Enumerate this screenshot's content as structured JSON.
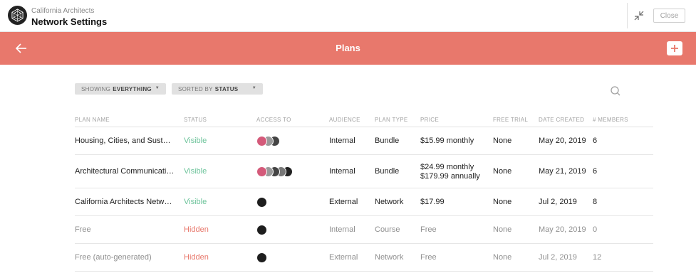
{
  "header": {
    "org_name": "California Architects",
    "page_name": "Network Settings",
    "close_label": "Close",
    "logo_icon": "hexagon-network-logo",
    "collapse_icon": "collapse-arrows-icon"
  },
  "banner": {
    "title": "Plans",
    "back_icon": "arrow-left-icon",
    "add_icon": "plus-icon",
    "color": "#e8786c"
  },
  "filters": {
    "showing_prefix": "SHOWING",
    "showing_value": "EVERYTHING",
    "sorted_prefix": "SORTED BY",
    "sorted_value": "STATUS",
    "search_icon": "search-icon"
  },
  "table": {
    "headers": [
      "PLAN NAME",
      "STATUS",
      "ACCESS TO",
      "AUDIENCE",
      "PLAN TYPE",
      "PRICE",
      "FREE TRIAL",
      "DATE CREATED",
      "# MEMBERS"
    ],
    "rows": [
      {
        "name": "Housing, Cities, and Sustain…",
        "status": "Visible",
        "access_count": 3,
        "audience": "Internal",
        "type": "Bundle",
        "price1": "$15.99 monthly",
        "price2": "",
        "trial": "None",
        "date": "May 20, 2019",
        "members": "6"
      },
      {
        "name": "Architectural Communicatio…",
        "status": "Visible",
        "access_count": 5,
        "audience": "Internal",
        "type": "Bundle",
        "price1": "$24.99 monthly",
        "price2": "$179.99 annually",
        "trial": "None",
        "date": "May 21, 2019",
        "members": "6"
      },
      {
        "name": "California Architects Networ…",
        "status": "Visible",
        "access_count": 1,
        "audience": "External",
        "type": "Network",
        "price1": "$17.99",
        "price2": "",
        "trial": "None",
        "date": "Jul 2, 2019",
        "members": "8"
      },
      {
        "name": "Free",
        "status": "Hidden",
        "access_count": 1,
        "audience": "Internal",
        "type": "Course",
        "price1": "Free",
        "price2": "",
        "trial": "None",
        "date": "May 20, 2019",
        "members": "0"
      },
      {
        "name": "Free (auto-generated)",
        "status": "Hidden",
        "access_count": 1,
        "audience": "External",
        "type": "Network",
        "price1": "Free",
        "price2": "",
        "trial": "None",
        "date": "Jul 2, 2019",
        "members": "12"
      }
    ]
  },
  "colors": {
    "visible": "#6cc39a",
    "hidden": "#e8786c"
  }
}
